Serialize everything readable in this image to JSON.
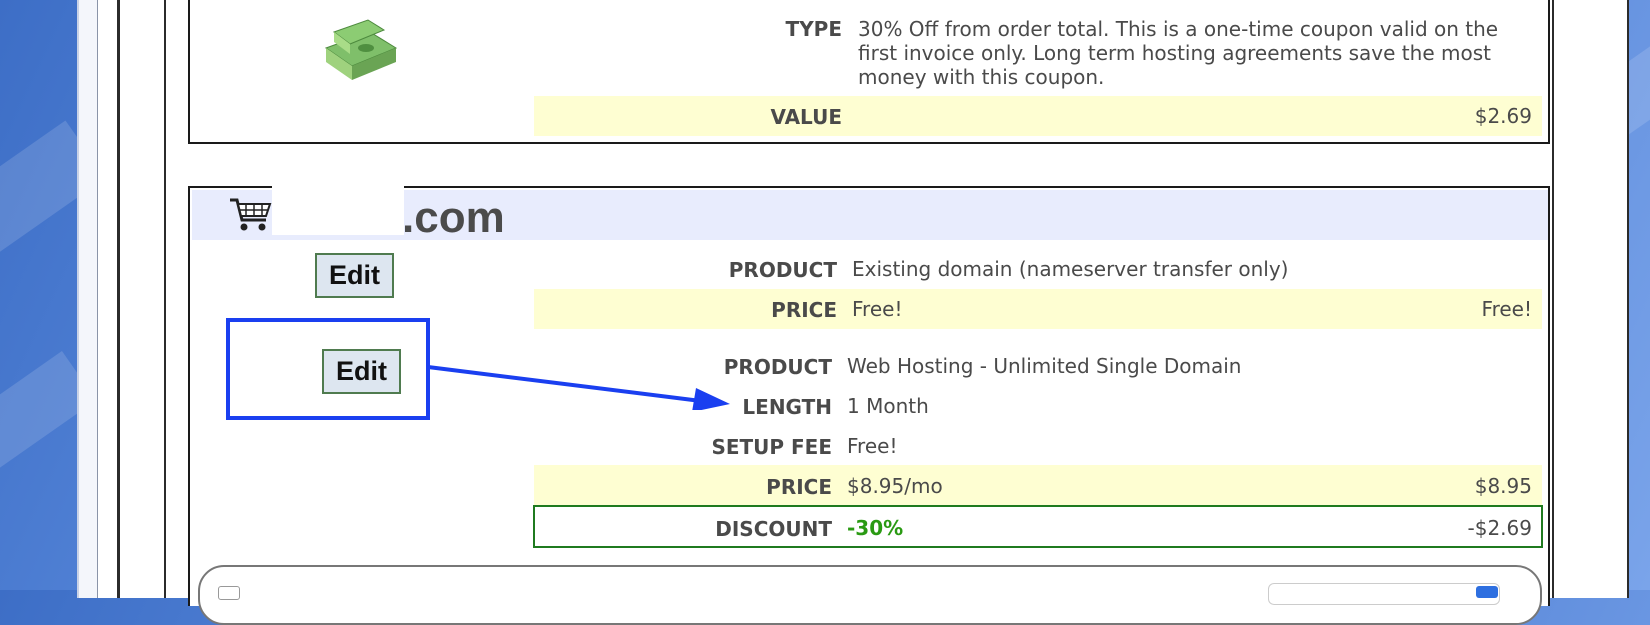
{
  "coupon": {
    "type_label": "TYPE",
    "type_lines": [
      "30% Off from order total. This is a one-time coupon valid on the",
      "first invoice only. Long term hosting agreements save the most",
      "money with this coupon."
    ],
    "value_label": "VALUE",
    "value_amount": "$2.69",
    "icon": "money-stack-icon"
  },
  "cart": {
    "icon": "shopping-cart-icon",
    "domain_suffix": ".com",
    "items": [
      {
        "edit_label": "Edit",
        "product_label": "PRODUCT",
        "product_value": "Existing domain (nameserver transfer only)",
        "price_label": "PRICE",
        "price_value": "Free!",
        "price_amount": "Free!"
      },
      {
        "edit_label": "Edit",
        "product_label": "PRODUCT",
        "product_value": "Web Hosting - Unlimited Single Domain",
        "length_label": "LENGTH",
        "length_value": "1 Month",
        "setup_label": "SETUP FEE",
        "setup_value": "Free!",
        "price_label": "PRICE",
        "price_value": "$8.95/mo",
        "price_amount": "$8.95",
        "discount_label": "DISCOUNT",
        "discount_value": "-30%",
        "discount_amount": "-$2.69"
      }
    ]
  },
  "colors": {
    "highlight_box": "#1a3ff0",
    "discount_green": "#2a9a13",
    "price_band": "#fefed2",
    "header_band": "#e8ecfd"
  }
}
